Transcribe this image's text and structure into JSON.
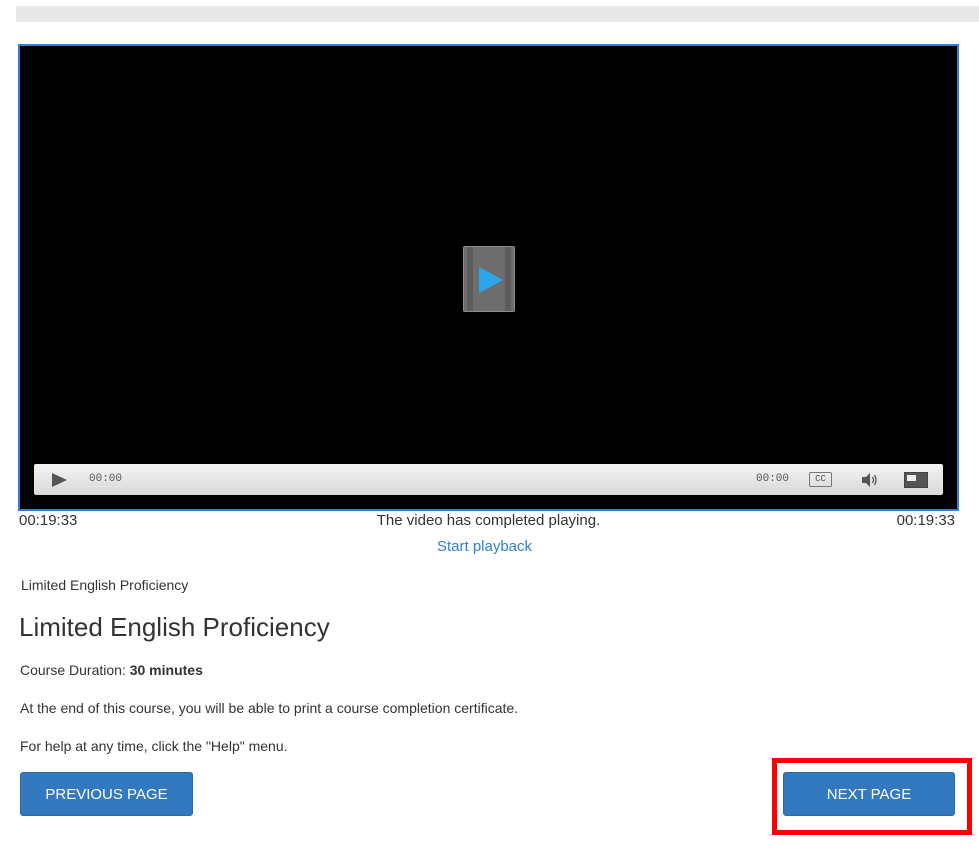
{
  "player": {
    "control_time_current": "00:00",
    "control_time_duration": "00:00",
    "cc_label": "CC",
    "icons": {
      "big_play": "play-icon",
      "control_play": "play-icon",
      "volume": "volume-icon",
      "fullscreen": "fullscreen-icon"
    },
    "accent_color": "#2ba6e8",
    "frame_border_color": "#2f7fd6"
  },
  "below_video": {
    "elapsed": "00:19:33",
    "status": "The video has completed playing.",
    "total": "00:19:33",
    "start_playback": "Start playback"
  },
  "course": {
    "small_title": "Limited English Proficiency",
    "title": "Limited English Proficiency",
    "duration_label": "Course Duration:",
    "duration_value": "30 minutes",
    "certificate_text": "At the end of this course, you will be able to print a course completion certificate.",
    "help_text": "For help at any time, click the \"Help\" menu."
  },
  "nav": {
    "previous_label": "PREVIOUS PAGE",
    "next_label": "NEXT PAGE",
    "button_color": "#3379bf",
    "highlight_color": "#ff0000"
  }
}
